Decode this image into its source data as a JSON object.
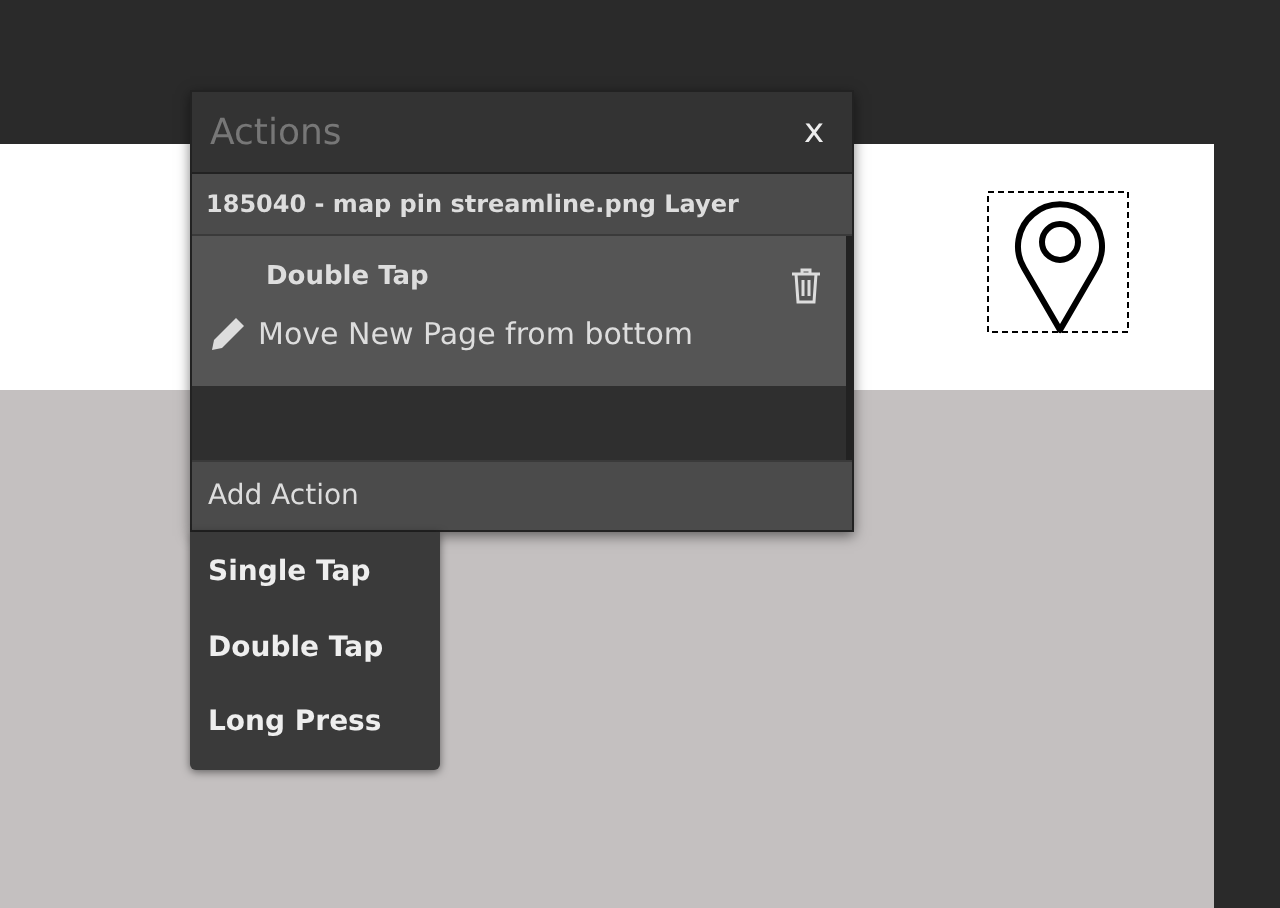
{
  "panel": {
    "title": "Actions",
    "close": "x",
    "layer": "185040 - map pin streamline.png Layer",
    "actions": [
      {
        "trigger": "Double Tap",
        "description": "Move New Page from bottom"
      }
    ],
    "add_action": "Add Action"
  },
  "menu": {
    "items": [
      {
        "label": "Single Tap"
      },
      {
        "label": "Double Tap"
      },
      {
        "label": "Long Press"
      }
    ]
  }
}
